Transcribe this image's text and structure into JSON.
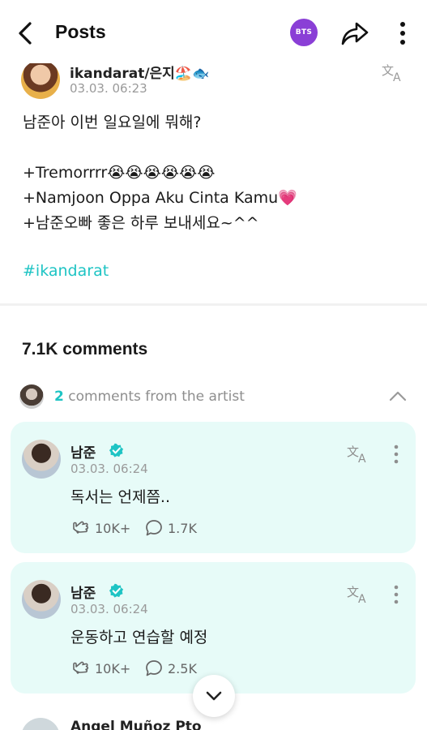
{
  "header": {
    "title": "Posts",
    "community_badge": "BTS"
  },
  "post": {
    "author_name": "ikandarat/은지🏖️🐟",
    "date": "03.03. 06:23",
    "lines": [
      "남준아 이번 일요일에 뭐해?",
      "",
      "+Tremorrrr😭😭😭😭😭😭",
      "+Namjoon Oppa Aku Cinta Kamu💗",
      "+남준오빠 좋은 하루 보내세요~^^"
    ],
    "hashtag": "#ikandarat"
  },
  "comments": {
    "count_label": "7.1K comments",
    "artist_count": "2",
    "artist_label": " comments from the artist",
    "items": [
      {
        "name": "남준",
        "date": "03.03. 06:24",
        "text": "독서는 언제쯤..",
        "likes": "10K+",
        "replies": "1.7K"
      },
      {
        "name": "남준",
        "date": "03.03. 06:24",
        "text": "운동하고 연습할 예정",
        "likes": "10K+",
        "replies": "2.5K"
      }
    ],
    "next_author": "Angel Muñoz Pto"
  },
  "icons": {
    "back": "chevron-left-icon",
    "share": "share-arrow-icon",
    "more": "more-vertical-icon",
    "translate": "translate-icon",
    "verified": "verified-badge-icon",
    "like": "hand-heart-icon",
    "reply": "speech-bubble-icon",
    "collapse": "chevron-up-icon",
    "scroll_down": "chevron-down-icon"
  },
  "colors": {
    "accent": "#1ec4c4",
    "community_badge": "#8a3fd6",
    "artist_card_bg": "#e7fbf8",
    "verified": "#1ec4c4"
  }
}
